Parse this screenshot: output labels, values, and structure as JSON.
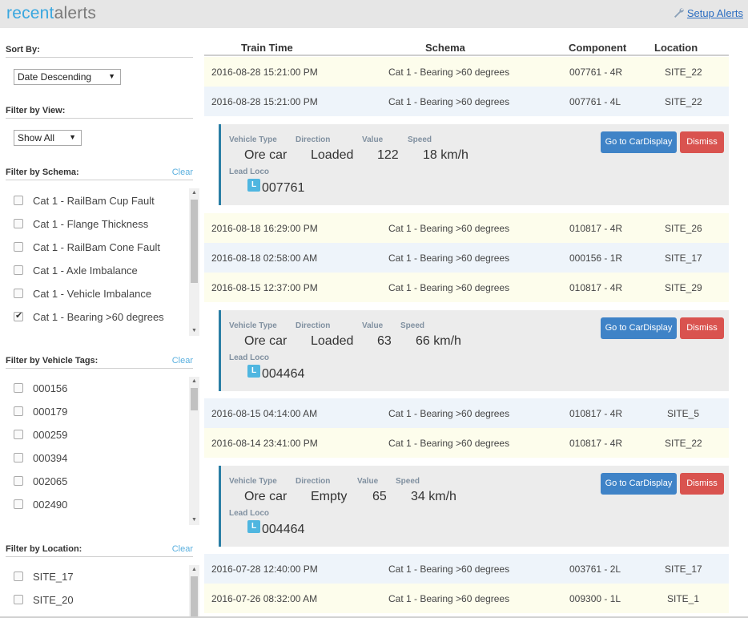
{
  "brand": {
    "part1": "recent",
    "part2": "alerts"
  },
  "header": {
    "setup_label": "Setup Alerts"
  },
  "sidebar": {
    "sort": {
      "title": "Sort By:",
      "selected": "Date Descending"
    },
    "view": {
      "title": "Filter by View:",
      "selected": "Show All"
    },
    "schema": {
      "title": "Filter by Schema:",
      "clear": "Clear",
      "items": [
        {
          "label": "Cat 1 - RailBam Cup Fault",
          "checked": false
        },
        {
          "label": "Cat 1 - Flange Thickness",
          "checked": false
        },
        {
          "label": "Cat 1 - RailBam Cone Fault",
          "checked": false
        },
        {
          "label": "Cat 1 - Axle Imbalance",
          "checked": false
        },
        {
          "label": "Cat 1 - Vehicle Imbalance",
          "checked": false
        },
        {
          "label": "Cat 1 - Bearing >60 degrees",
          "checked": true
        }
      ]
    },
    "tags": {
      "title": "Filter by Vehicle Tags:",
      "clear": "Clear",
      "items": [
        {
          "label": "000156",
          "checked": false
        },
        {
          "label": "000179",
          "checked": false
        },
        {
          "label": "000259",
          "checked": false
        },
        {
          "label": "000394",
          "checked": false
        },
        {
          "label": "002065",
          "checked": false
        },
        {
          "label": "002490",
          "checked": false
        }
      ]
    },
    "location": {
      "title": "Filter by Location:",
      "clear": "Clear",
      "items": [
        {
          "label": "SITE_17",
          "checked": false
        },
        {
          "label": "SITE_20",
          "checked": false
        }
      ]
    }
  },
  "table": {
    "columns": [
      "Train Time",
      "Schema",
      "Component",
      "Location"
    ],
    "rows": [
      {
        "time": "2016-08-28 15:21:00 PM",
        "schema": "Cat 1 - Bearing >60 degrees",
        "component": "007761 - 4R",
        "location": "SITE_22",
        "shade": "yellow"
      },
      {
        "time": "2016-08-28 15:21:00 PM",
        "schema": "Cat 1 - Bearing >60 degrees",
        "component": "007761 - 4L",
        "location": "SITE_22",
        "shade": "blue"
      },
      {
        "time": "2016-08-18 16:29:00 PM",
        "schema": "Cat 1 - Bearing >60 degrees",
        "component": "010817 - 4R",
        "location": "SITE_26",
        "shade": "yellow"
      },
      {
        "time": "2016-08-18 02:58:00 AM",
        "schema": "Cat 1 - Bearing >60 degrees",
        "component": "000156 - 1R",
        "location": "SITE_17",
        "shade": "blue"
      },
      {
        "time": "2016-08-15 12:37:00 PM",
        "schema": "Cat 1 - Bearing >60 degrees",
        "component": "010817 - 4R",
        "location": "SITE_29",
        "shade": "yellow"
      },
      {
        "time": "2016-08-15 04:14:00 AM",
        "schema": "Cat 1 - Bearing >60 degrees",
        "component": "010817 - 4R",
        "location": "SITE_5",
        "shade": "blue"
      },
      {
        "time": "2016-08-14 23:41:00 PM",
        "schema": "Cat 1 - Bearing >60 degrees",
        "component": "010817 - 4R",
        "location": "SITE_22",
        "shade": "yellow"
      },
      {
        "time": "2016-07-28 12:40:00 PM",
        "schema": "Cat 1 - Bearing >60 degrees",
        "component": "003761 - 2L",
        "location": "SITE_17",
        "shade": "blue"
      },
      {
        "time": "2016-07-26 08:32:00 AM",
        "schema": "Cat 1 - Bearing >60 degrees",
        "component": "009300 - 1L",
        "location": "SITE_1",
        "shade": "yellow"
      }
    ]
  },
  "detail_labels": {
    "vehicle_type": "Vehicle Type",
    "direction": "Direction",
    "value": "Value",
    "speed": "Speed",
    "lead_loco": "Lead Loco",
    "loco_badge": "L"
  },
  "buttons": {
    "go": "Go to CarDisplay",
    "dismiss": "Dismiss"
  },
  "details": [
    {
      "vehicle_type": "Ore car",
      "direction": "Loaded",
      "value": "122",
      "speed": "18 km/h",
      "lead_loco": "007761"
    },
    {
      "vehicle_type": "Ore car",
      "direction": "Loaded",
      "value": "63",
      "speed": "66 km/h",
      "lead_loco": "004464"
    },
    {
      "vehicle_type": "Ore car",
      "direction": "Empty",
      "value": "65",
      "speed": "34 km/h",
      "lead_loco": "004464"
    }
  ]
}
